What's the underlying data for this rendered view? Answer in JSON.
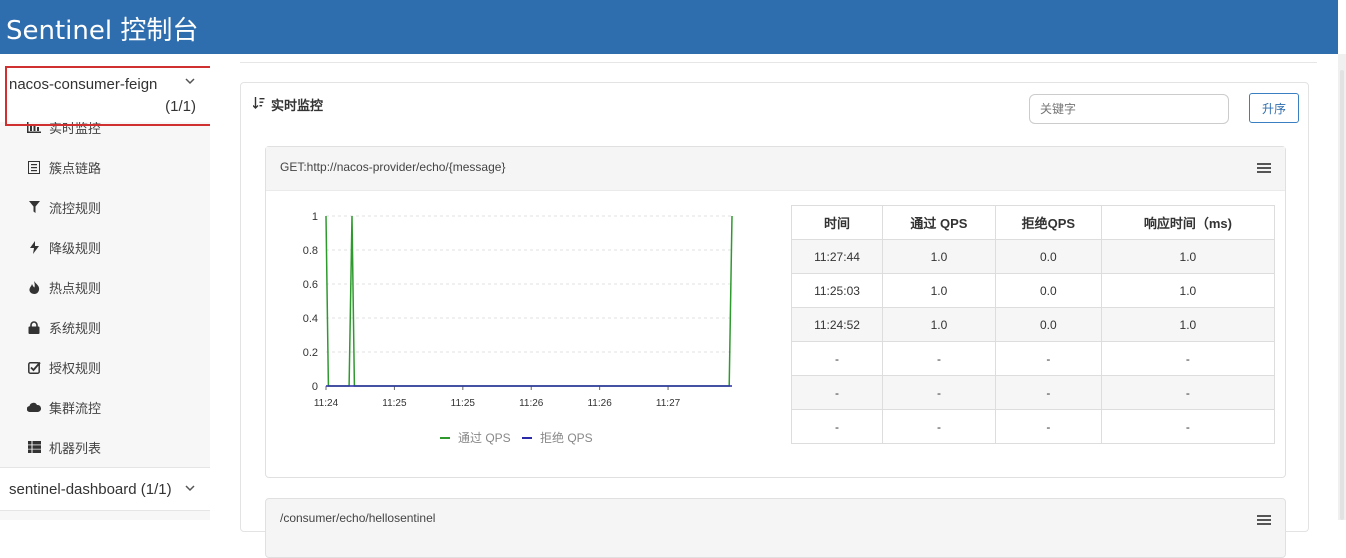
{
  "header": {
    "title": "Sentinel 控制台"
  },
  "sidebar": {
    "app": {
      "name": "nacos-consumer-feign",
      "count": "(1/1)"
    },
    "items": [
      {
        "label": "实时监控",
        "icon": "bar-chart-icon"
      },
      {
        "label": "簇点链路",
        "icon": "list-icon"
      },
      {
        "label": "流控规则",
        "icon": "filter-icon"
      },
      {
        "label": "降级规则",
        "icon": "flash-icon"
      },
      {
        "label": "热点规则",
        "icon": "fire-icon"
      },
      {
        "label": "系统规则",
        "icon": "lock-icon"
      },
      {
        "label": "授权规则",
        "icon": "check-square-icon"
      },
      {
        "label": "集群流控",
        "icon": "cloud-icon"
      },
      {
        "label": "机器列表",
        "icon": "th-list-icon"
      }
    ],
    "app2": {
      "name": "sentinel-dashboard (1/1)"
    }
  },
  "panel": {
    "title": "实时监控",
    "search_placeholder": "关键字",
    "sort_label": "升序"
  },
  "resource1": {
    "name": "GET:http://nacos-provider/echo/{message}",
    "table": {
      "headers": [
        "时间",
        "通过 QPS",
        "拒绝QPS",
        "响应时间（ms)"
      ],
      "rows": [
        [
          "11:27:44",
          "1.0",
          "0.0",
          "1.0"
        ],
        [
          "11:25:03",
          "1.0",
          "0.0",
          "1.0"
        ],
        [
          "11:24:52",
          "1.0",
          "0.0",
          "1.0"
        ],
        [
          "-",
          "-",
          "-",
          "-"
        ],
        [
          "-",
          "-",
          "-",
          "-"
        ],
        [
          "-",
          "-",
          "-",
          "-"
        ]
      ]
    }
  },
  "resource2": {
    "name": "/consumer/echo/hellosentinel"
  },
  "chart_data": {
    "type": "line",
    "x_ticks": [
      "11:24",
      "11:25",
      "11:25",
      "11:26",
      "11:26",
      "11:27"
    ],
    "y_ticks": [
      "0",
      "0.2",
      "0.4",
      "0.6",
      "0.8",
      "1"
    ],
    "ylim": [
      0,
      1
    ],
    "grid": true,
    "legend_position": "bottom",
    "series": [
      {
        "name": "通过 QPS",
        "color": "#2e9a2e",
        "points": [
          [
            0,
            1
          ],
          [
            0.006,
            0
          ],
          [
            0.057,
            0
          ],
          [
            0.064,
            1
          ],
          [
            0.07,
            0
          ],
          [
            0.993,
            0
          ],
          [
            1,
            1
          ]
        ]
      },
      {
        "name": "拒绝 QPS",
        "color": "#2a2aa8",
        "points": [
          [
            0,
            0
          ],
          [
            1,
            0
          ]
        ]
      }
    ]
  }
}
